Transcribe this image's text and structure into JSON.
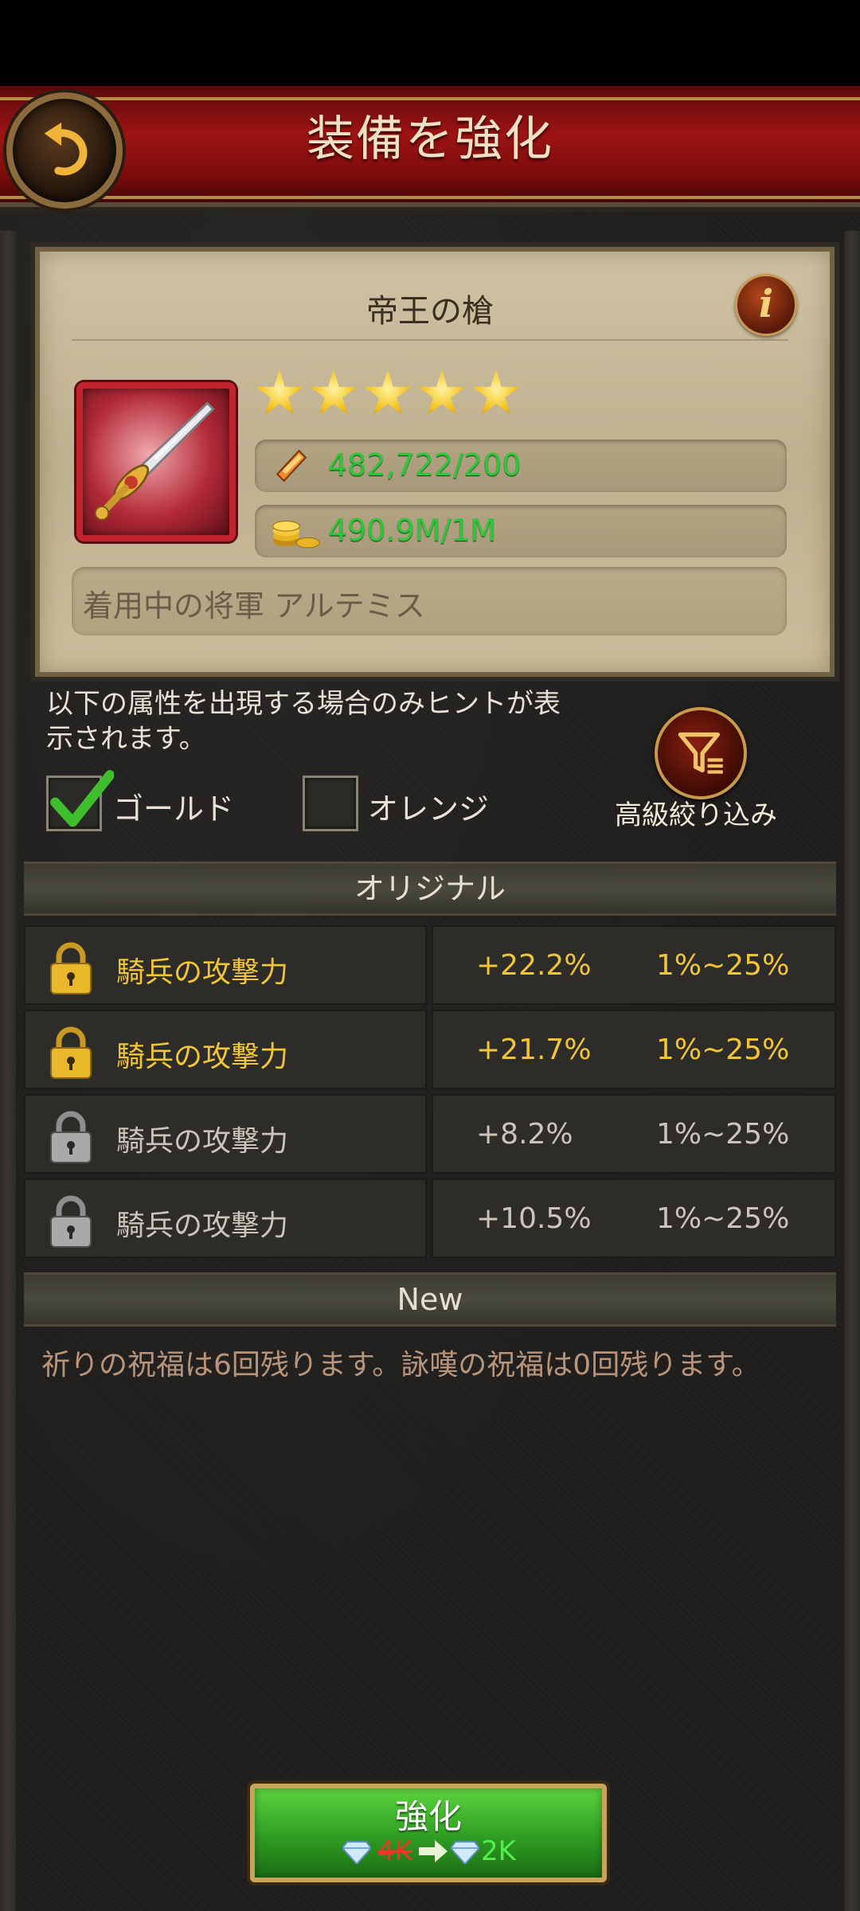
{
  "header": {
    "title": "装備を強化"
  },
  "item": {
    "name": "帝王の槍",
    "stars": 5,
    "material": "482,722/200",
    "gold": "490.9M/1M",
    "equipped_by": "着用中の将軍 アルテミス"
  },
  "hint": {
    "text": "以下の属性を出現する場合のみヒントが表示されます。",
    "options": [
      {
        "label": "ゴールド",
        "checked": true
      },
      {
        "label": "オレンジ",
        "checked": false
      }
    ],
    "filter_label": "高級絞り込み"
  },
  "original": {
    "title": "オリジナル",
    "rows": [
      {
        "name": "騎兵の攻撃力",
        "value": "+22.2%",
        "range": "1%~25%",
        "locked": true,
        "color": "#f2c534"
      },
      {
        "name": "騎兵の攻撃力",
        "value": "+21.7%",
        "range": "1%~25%",
        "locked": true,
        "color": "#f2c534"
      },
      {
        "name": "騎兵の攻撃力",
        "value": "+8.2%",
        "range": "1%~25%",
        "locked": false,
        "color": "#c9c5bb"
      },
      {
        "name": "騎兵の攻撃力",
        "value": "+10.5%",
        "range": "1%~25%",
        "locked": false,
        "color": "#c9c5bb"
      }
    ]
  },
  "new_section": {
    "title": "New",
    "blessing_text": "祈りの祝福は6回残ります。詠嘆の祝福は0回残ります。"
  },
  "enhance": {
    "label": "強化",
    "cost_old": "4K",
    "cost_new": "2K"
  }
}
